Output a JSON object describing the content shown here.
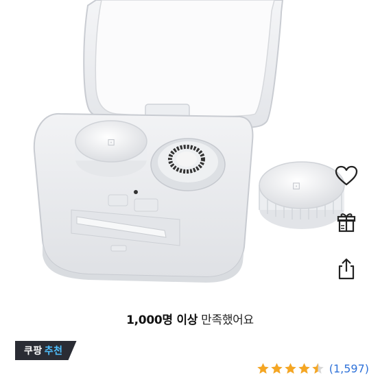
{
  "product": {
    "image_alt": "contact lens case",
    "satisfaction_bold": "1,000명 이상",
    "satisfaction_rest": "만족했어요"
  },
  "actions": {
    "wishlist_icon": "heart-icon",
    "gift_icon": "gift-icon",
    "share_icon": "share-icon"
  },
  "badge": {
    "prefix": "쿠팡",
    "accent": "추천"
  },
  "rating": {
    "stars": 4.5,
    "max_stars": 5,
    "review_count": "(1,597)"
  },
  "colors": {
    "star": "#f5a623",
    "link": "#2f72d9",
    "badge_bg": "#2a2c34",
    "badge_accent": "#4fc0ff"
  }
}
